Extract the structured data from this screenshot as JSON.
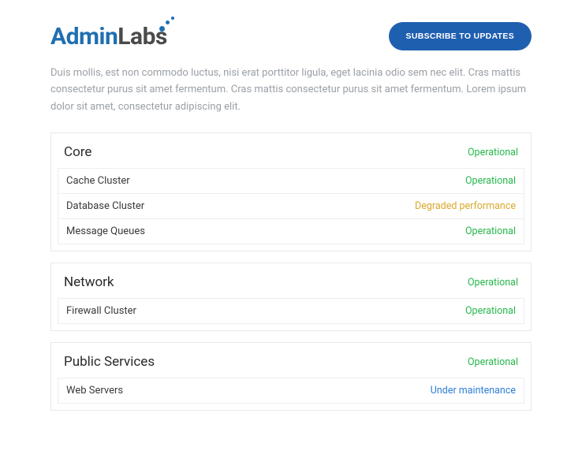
{
  "header": {
    "logo_part1": "Admin",
    "logo_part2": "Labs",
    "subscribe_label": "SUBSCRIBE TO UPDATES"
  },
  "description": "Duis mollis, est non commodo luctus, nisi erat porttitor ligula, eget lacinia odio sem nec elit. Cras mattis consectetur purus sit amet fermentum. Cras mattis consectetur purus sit amet fermentum. Lorem ipsum dolor sit amet, consectetur adipiscing elit.",
  "status_colors": {
    "operational": "#27b84c",
    "degraded": "#d9a92b",
    "maintenance": "#2d7ed8"
  },
  "groups": [
    {
      "name": "Core",
      "status": "Operational",
      "status_class": "operational",
      "items": [
        {
          "name": "Cache Cluster",
          "status": "Operational",
          "status_class": "operational"
        },
        {
          "name": "Database Cluster",
          "status": "Degraded performance",
          "status_class": "degraded"
        },
        {
          "name": "Message Queues",
          "status": "Operational",
          "status_class": "operational"
        }
      ]
    },
    {
      "name": "Network",
      "status": "Operational",
      "status_class": "operational",
      "items": [
        {
          "name": "Firewall Cluster",
          "status": "Operational",
          "status_class": "operational"
        }
      ]
    },
    {
      "name": "Public Services",
      "status": "Operational",
      "status_class": "operational",
      "items": [
        {
          "name": "Web Servers",
          "status": "Under maintenance",
          "status_class": "maintenance"
        }
      ]
    }
  ]
}
